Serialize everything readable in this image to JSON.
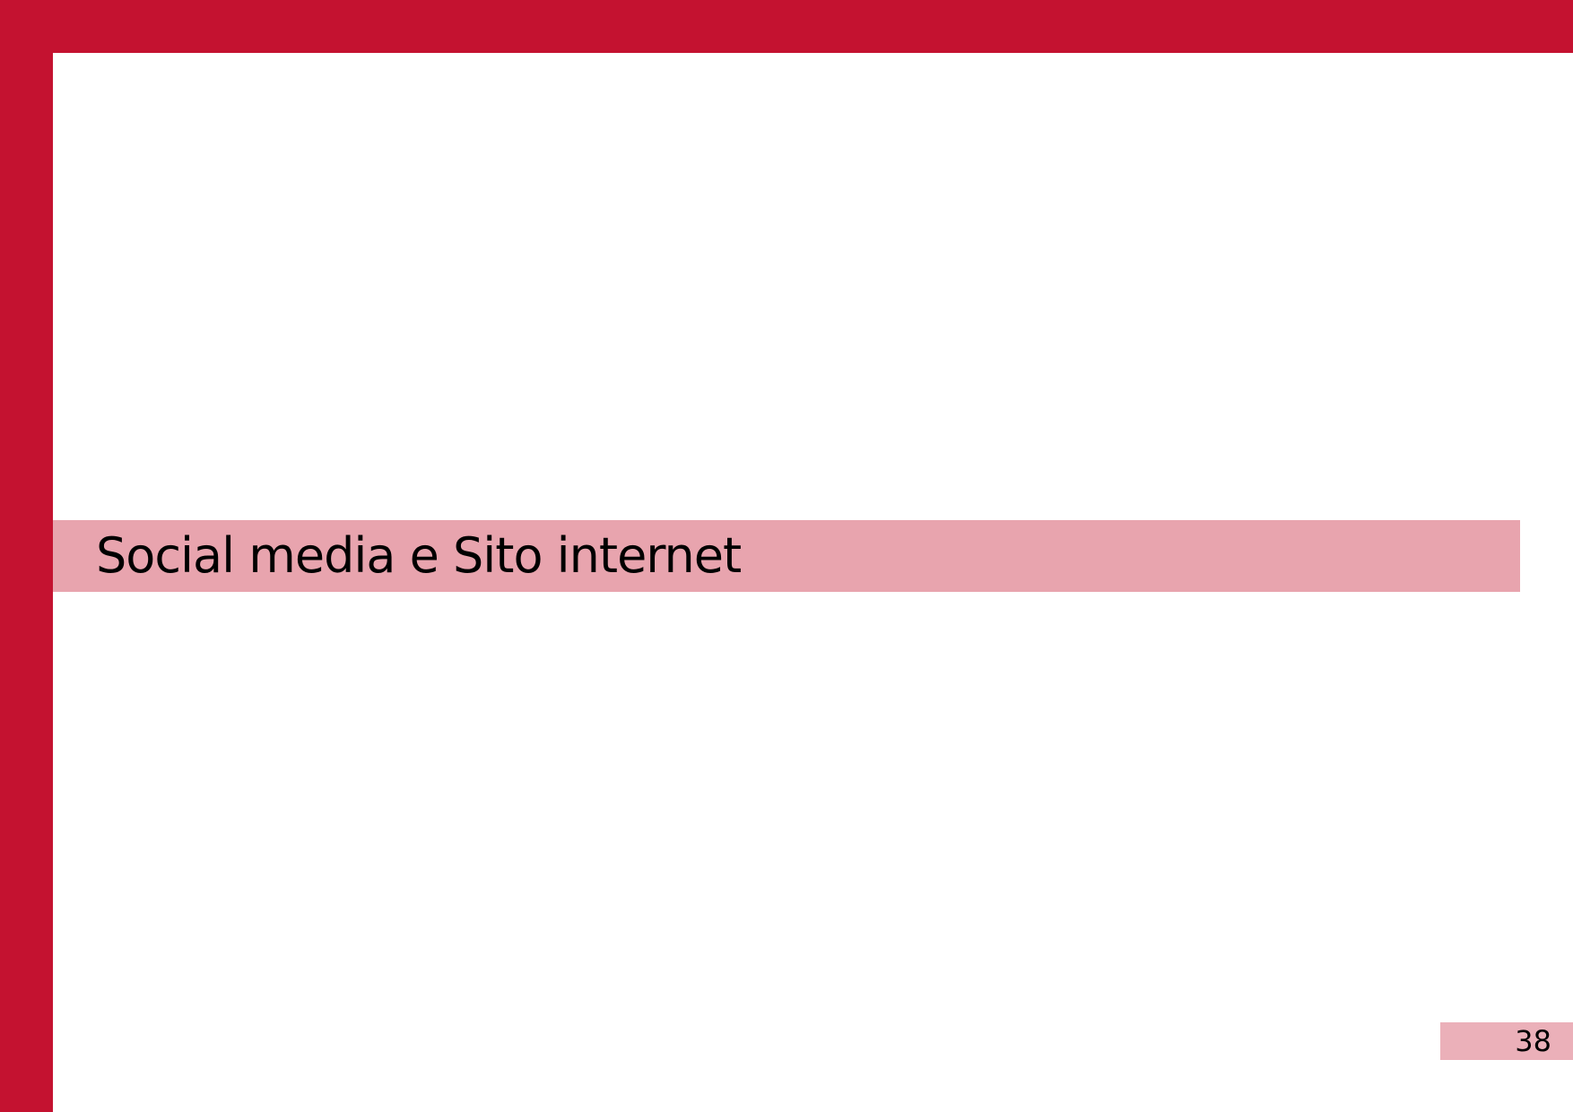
{
  "page": {
    "section_title": "Social media e Sito internet",
    "page_number": "38"
  },
  "colors": {
    "frame": "#c41230",
    "band": "#e8a4ae",
    "page_number_box": "#ebb0b9",
    "text": "#000000",
    "background": "#ffffff"
  }
}
